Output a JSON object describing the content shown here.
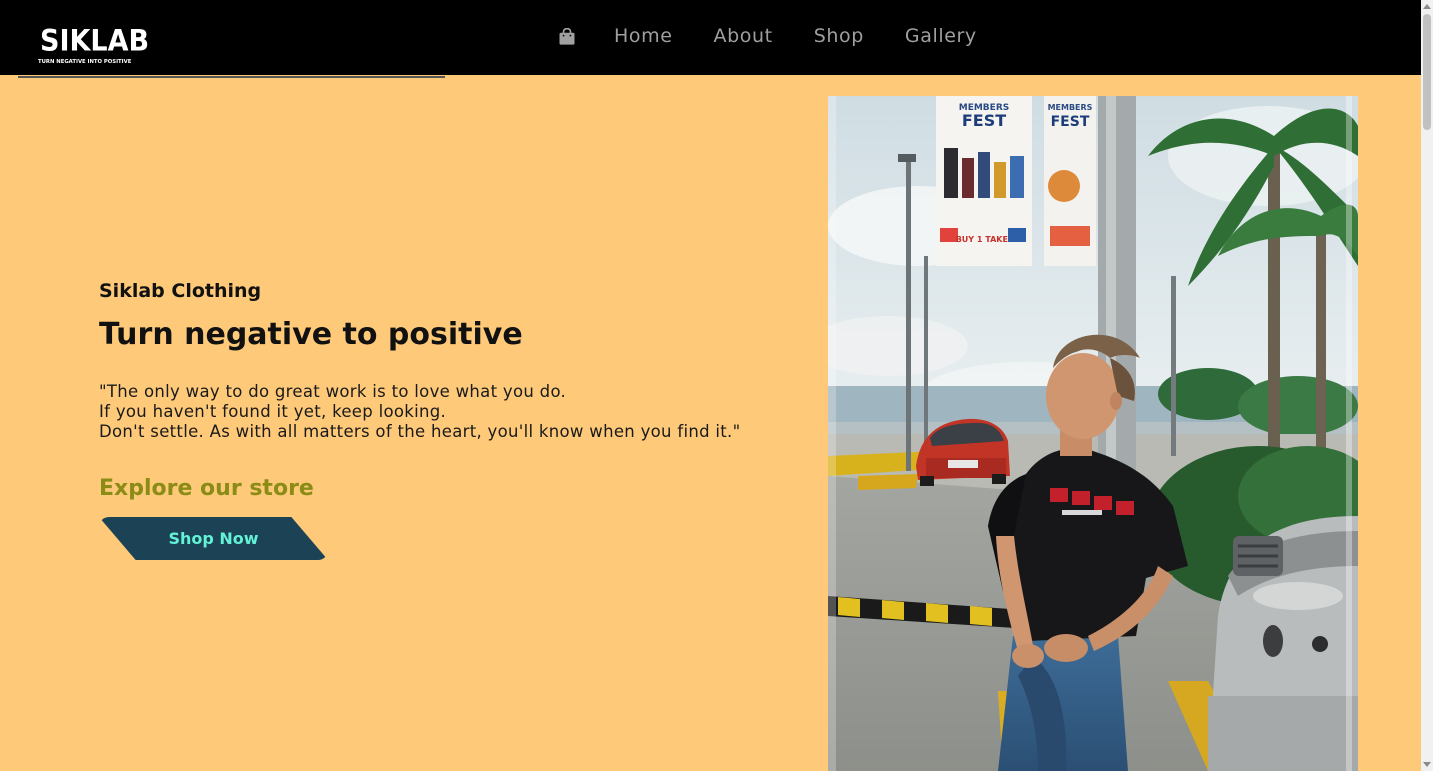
{
  "header": {
    "logo": {
      "text": "SIKLAB",
      "tagline": "TURN NEGATIVE INTO POSITIVE"
    },
    "cart_icon": "shopping-bag-icon",
    "nav": [
      {
        "label": "Home"
      },
      {
        "label": "About"
      },
      {
        "label": "Shop"
      },
      {
        "label": "Gallery"
      }
    ]
  },
  "hero": {
    "brand": "Siklab Clothing",
    "headline": "Turn negative to positive",
    "quote": [
      "\"The only way to do great work is to love what you do.",
      "If you haven't found it yet, keep looking.",
      "Don't settle. As with all matters of the heart, you'll know when you find it.\""
    ],
    "explore": "Explore our store",
    "cta_label": "Shop Now"
  },
  "photo": {
    "sign_left": {
      "line1": "MEMBERS",
      "line2": "FEST",
      "promo": "BUY 1 TAKE 1"
    },
    "sign_right": {
      "line1": "MEMBERS",
      "line2": "FEST"
    }
  },
  "colors": {
    "page_background": "#fec978",
    "navbar": "#000000",
    "nav_text": "#9f9f9f",
    "explore_text": "#8a8c16",
    "button_bg": "#1b4255",
    "button_text": "#64f2d6"
  }
}
